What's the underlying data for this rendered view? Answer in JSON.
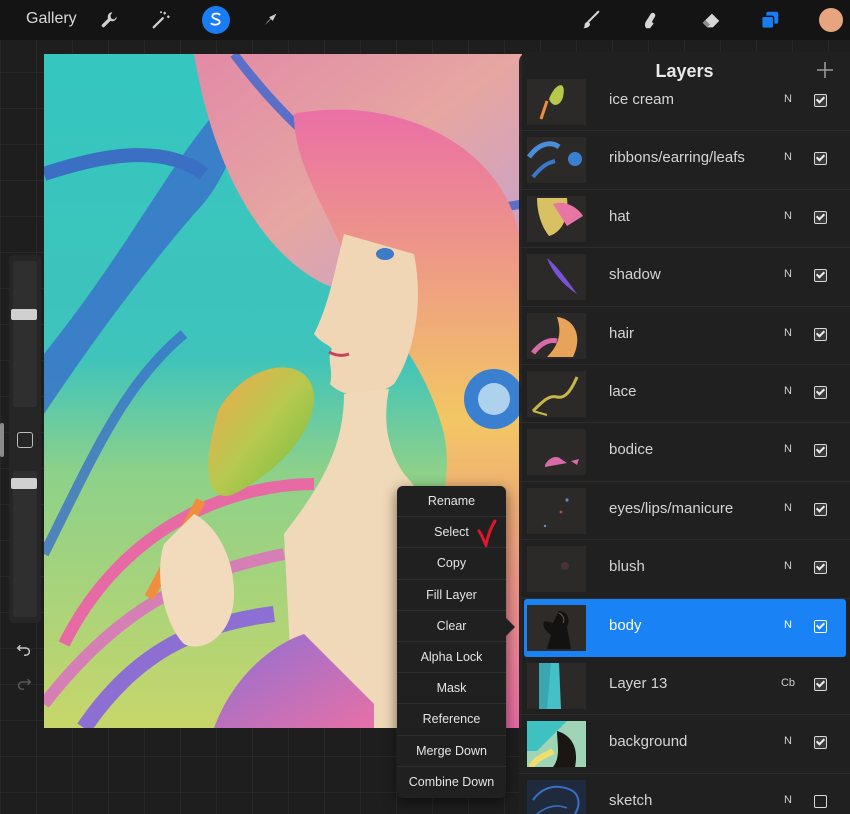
{
  "toolbar": {
    "gallery_label": "Gallery",
    "left_icons": [
      "wrench-icon",
      "magic-wand-icon",
      "selection-icon",
      "transform-arrow-icon"
    ],
    "right_icons": [
      "brush-icon",
      "smudge-icon",
      "eraser-icon",
      "layers-icon"
    ],
    "active_left_tool": "selection-icon",
    "active_right_tool": "layers-icon",
    "color_swatch": "#e7a57f",
    "accent": "#1a7cf2"
  },
  "context_menu": {
    "items": [
      "Rename",
      "Select",
      "Copy",
      "Fill Layer",
      "Clear",
      "Alpha Lock",
      "Mask",
      "Reference",
      "Merge Down",
      "Combine Down"
    ],
    "annotated_item": "Select",
    "annotation_color": "#e0162b"
  },
  "layers": {
    "title": "Layers",
    "selected_color": "#1982f4",
    "items": [
      {
        "name": "ice cream",
        "blend": "N",
        "visible": true,
        "selected": false
      },
      {
        "name": "ribbons/earring/leafs",
        "blend": "N",
        "visible": true,
        "selected": false
      },
      {
        "name": "hat",
        "blend": "N",
        "visible": true,
        "selected": false
      },
      {
        "name": "shadow",
        "blend": "N",
        "visible": true,
        "selected": false
      },
      {
        "name": "hair",
        "blend": "N",
        "visible": true,
        "selected": false
      },
      {
        "name": "lace",
        "blend": "N",
        "visible": true,
        "selected": false
      },
      {
        "name": "bodice",
        "blend": "N",
        "visible": true,
        "selected": false
      },
      {
        "name": "eyes/lips/manicure",
        "blend": "N",
        "visible": true,
        "selected": false
      },
      {
        "name": "blush",
        "blend": "N",
        "visible": true,
        "selected": false
      },
      {
        "name": "body",
        "blend": "N",
        "visible": true,
        "selected": true
      },
      {
        "name": "Layer 13",
        "blend": "Cb",
        "visible": true,
        "selected": false
      },
      {
        "name": "background",
        "blend": "N",
        "visible": true,
        "selected": false
      },
      {
        "name": "sketch",
        "blend": "N",
        "visible": false,
        "selected": false
      }
    ]
  }
}
